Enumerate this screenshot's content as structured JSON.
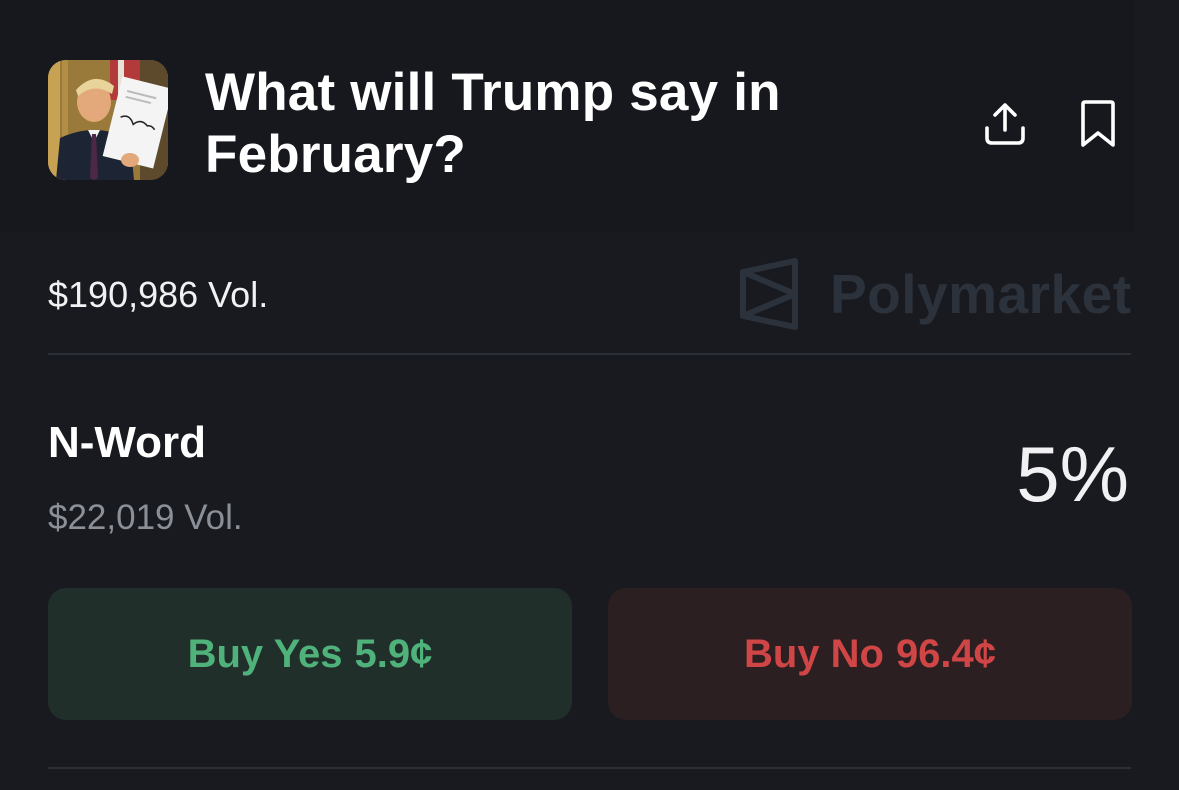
{
  "market": {
    "title": "What will Trump say in February?",
    "thumbnail_icon": "market-photo-thumbnail",
    "share_icon": "share-icon",
    "bookmark_icon": "bookmark-icon",
    "volume": "$190,986 Vol."
  },
  "brand": {
    "name": "Polymarket",
    "logo_icon": "polymarket-logo-icon"
  },
  "outcome": {
    "name": "N-Word",
    "volume": "$22,019 Vol.",
    "probability": "5%",
    "buy_yes": {
      "label": "Buy Yes",
      "price": "5.9¢"
    },
    "buy_no": {
      "label": "Buy No",
      "price": "96.4¢"
    }
  },
  "colors": {
    "background": "#181a1f",
    "yes_text": "#4fb27a",
    "yes_bg": "#212f2b",
    "no_text": "#d04545",
    "no_bg": "#2c1f22",
    "muted_text": "#8a8f98",
    "brand_watermark": "#2c323b"
  }
}
